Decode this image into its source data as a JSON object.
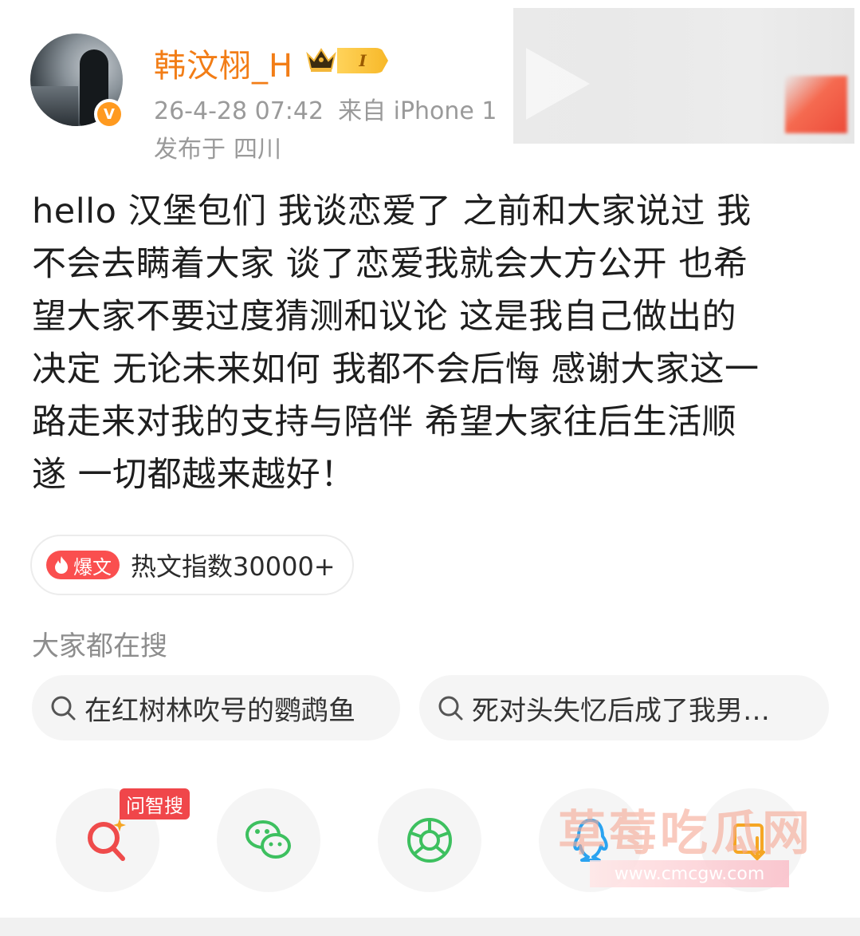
{
  "user": {
    "name": "韩汶栩_H",
    "level": "I",
    "verified_mark": "V",
    "timestamp": "26-4-28 07:42",
    "source": "来自 iPhone 1",
    "location_prefix": "发布于",
    "location": "四川"
  },
  "post": {
    "lines": [
      "hello 汉堡包们 我谈恋爱了 之前和大家说过 我",
      "不会去瞒着大家 谈了恋爱我就会大方公开 也希",
      "望大家不要过度猜测和议论 这是我自己做出的",
      "决定 无论未来如何 我都不会后悔 感谢大家这一",
      "路走来对我的支持与陪伴 希望大家往后生活顺",
      "遂 一切都越来越好！"
    ]
  },
  "hot": {
    "tag": "爆文",
    "text": "热文指数30000+"
  },
  "search": {
    "heading": "大家都在搜",
    "suggestions": [
      "在红树林吹号的鹦鹉鱼",
      "死对头失忆后成了我男…"
    ]
  },
  "share": {
    "ai_tag": "问智搜",
    "icons": [
      "ai-search-icon",
      "wechat-icon",
      "moments-icon",
      "qq-icon",
      "repost-icon"
    ]
  },
  "watermark": {
    "text": "草莓吃瓜网",
    "url": "www.cmcgw.com"
  },
  "colors": {
    "username": "#f27d16",
    "hot_tag": "#fa4f4f",
    "verified": "#ff9a1f",
    "wechat": "#3dc05f"
  }
}
